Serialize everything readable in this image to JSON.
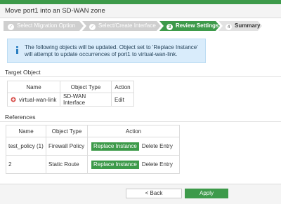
{
  "dialog": {
    "title": "Move port1 into an SD-WAN zone"
  },
  "wizard": {
    "steps": [
      {
        "num": "1",
        "label": "Select Migration Option",
        "state": "done"
      },
      {
        "num": "2",
        "label": "Select/Create Interface",
        "state": "done"
      },
      {
        "num": "3",
        "label": "Review Settings",
        "state": "active"
      },
      {
        "num": "4",
        "label": "Summary",
        "state": "todo"
      }
    ]
  },
  "notice": {
    "icon": "info-icon",
    "text": "The following objects will be updated. Object set to 'Replace Instance' will attempt to update occurrences of port1 to virtual-wan-link."
  },
  "target": {
    "section_label": "Target Object",
    "columns": [
      "Name",
      "Object Type",
      "Action"
    ],
    "row": {
      "icon": "sdwan-interface-icon",
      "name": "virtual-wan-link",
      "type": "SD-WAN Interface",
      "action": "Edit"
    }
  },
  "references": {
    "section_label": "References",
    "columns": [
      "Name",
      "Object Type",
      "Action"
    ],
    "rows": [
      {
        "name": "test_policy (1)",
        "type": "Firewall Policy",
        "replace_label": "Replace Instance",
        "delete_label": "Delete Entry"
      },
      {
        "name": "2",
        "type": "Static Route",
        "replace_label": "Replace Instance",
        "delete_label": "Delete Entry"
      }
    ]
  },
  "footer": {
    "back_label": "< Back",
    "apply_label": "Apply"
  },
  "colors": {
    "accent": "#3d9a4a",
    "notice_bg": "#d9ecfb",
    "icon_red": "#d9534f"
  }
}
